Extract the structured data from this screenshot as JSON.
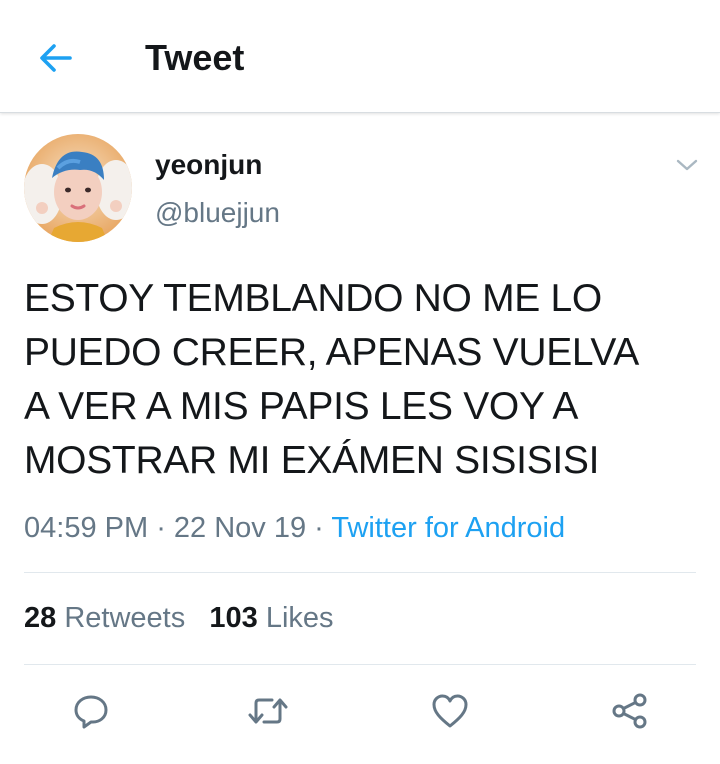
{
  "header": {
    "title": "Tweet",
    "back_icon": "arrow-left-icon",
    "accent_color": "#1da1f2"
  },
  "tweet": {
    "author": {
      "name": "yeonjun",
      "handle": "@bluejjun"
    },
    "text_lines": [
      "ESTOY TEMBLANDO NO ME LO",
      "PUEDO CREER, APENAS VUELVA",
      "A VER A MIS PAPIS LES VOY A",
      "MOSTRAR MI EXÁMEN SISISISI"
    ],
    "time": "04:59 PM",
    "separator": " · ",
    "date": "22 Nov 19",
    "source": "Twitter for Android",
    "stats": {
      "retweets_count": "28",
      "retweets_label": "Retweets",
      "likes_count": "103",
      "likes_label": "Likes"
    }
  },
  "actions": [
    "reply-icon",
    "retweet-icon",
    "like-icon",
    "share-icon"
  ],
  "colors": {
    "text": "#14171a",
    "secondary": "#657786",
    "link": "#1da1f2",
    "divider": "#e1e8ed"
  }
}
